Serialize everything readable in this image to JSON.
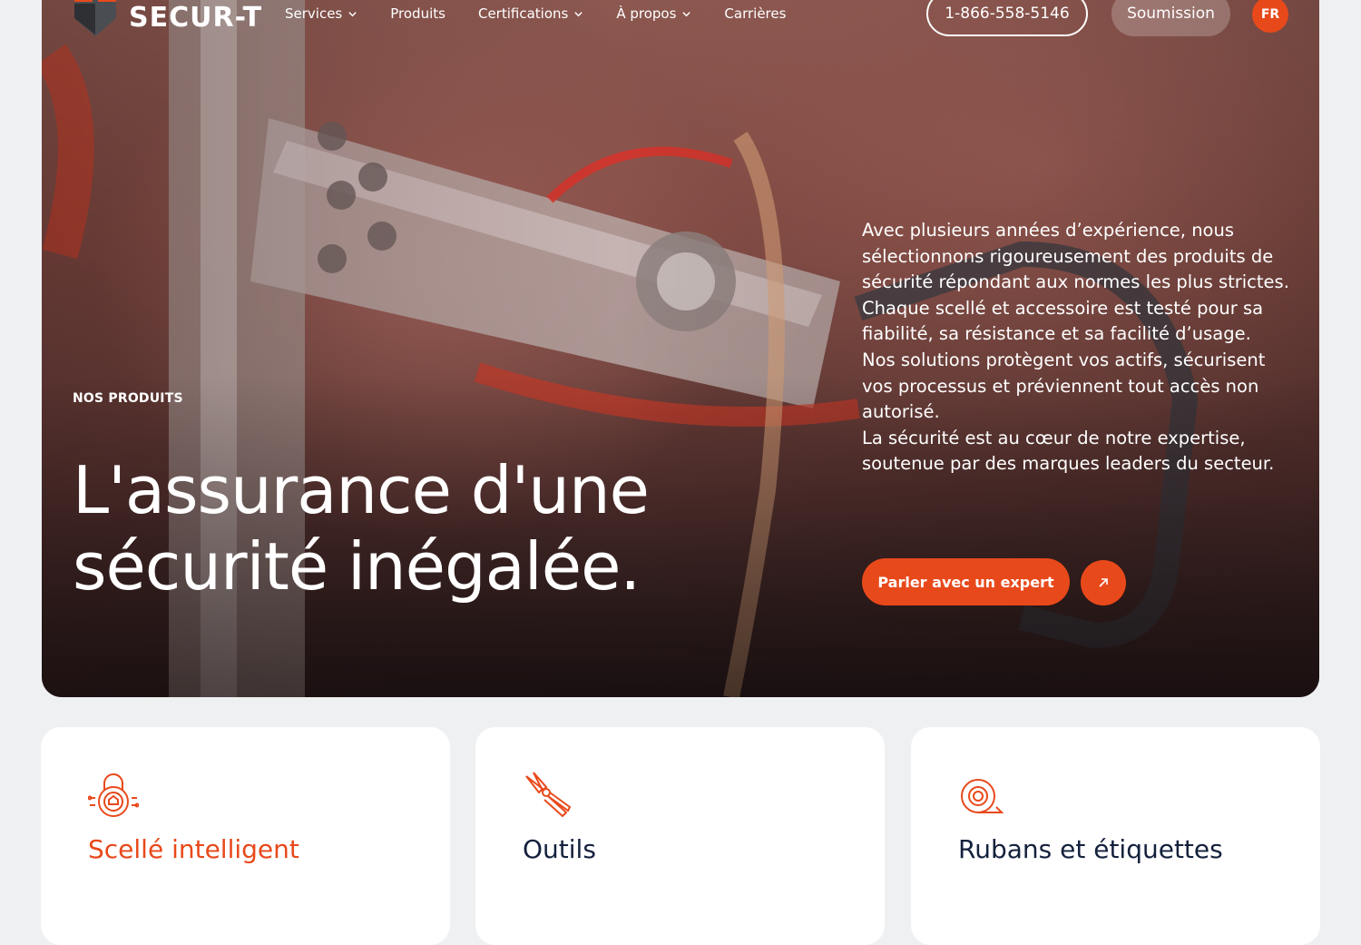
{
  "brand": {
    "name": "SECUR-T",
    "accent": "#e8491b",
    "navy": "#14213d"
  },
  "nav": {
    "items": [
      {
        "label": "Services",
        "dropdown": true
      },
      {
        "label": "Produits",
        "dropdown": false
      },
      {
        "label": "Certifications",
        "dropdown": true
      },
      {
        "label": "À propos",
        "dropdown": true
      },
      {
        "label": "Carrières",
        "dropdown": false
      }
    ],
    "phone": "1-866-558-5146",
    "quote": "Soumission",
    "lang": "FR"
  },
  "hero": {
    "eyebrow": "NOS PRODUITS",
    "headline_line1": "L'assurance d'une",
    "headline_line2": "sécurité inégalée.",
    "intro": [
      "Avec plusieurs années d’expérience, nous sélectionnons rigoureusement des produits de sécurité répondant aux normes les plus strictes.",
      "Chaque scellé et accessoire est testé pour sa fiabilité, sa résistance et sa facilité d’usage.",
      "Nos solutions protègent vos actifs, sécurisent vos processus et préviennent tout accès non autorisé.",
      "La sécurité est au cœur de notre expertise, soutenue par des marques leaders du secteur."
    ],
    "cta": "Parler avec un expert",
    "cta_icon": "arrow-up-right-icon"
  },
  "cards": [
    {
      "title": "Scellé intelligent",
      "icon": "smart-lock-icon"
    },
    {
      "title": "Outils",
      "icon": "cutter-tool-icon"
    },
    {
      "title": "Rubans et étiquettes",
      "icon": "tape-roll-icon"
    }
  ]
}
